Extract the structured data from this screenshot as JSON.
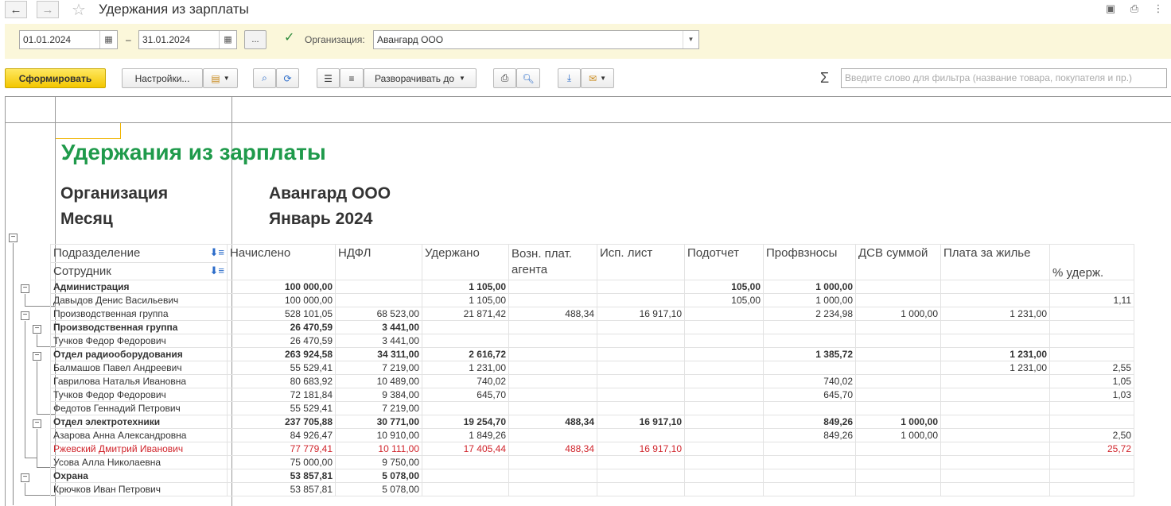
{
  "window": {
    "title": "Удержания из зарплаты"
  },
  "params": {
    "date_from": "01.01.2024",
    "date_to": "31.01.2024",
    "dash": "–",
    "more_button": "...",
    "org_label": "Организация:",
    "org_value": "Авангард ООО",
    "org_checked": true
  },
  "toolbar": {
    "generate": "Сформировать",
    "settings": "Настройки...",
    "expand_to": "Разворачивать до",
    "filter_placeholder": "Введите слово для фильтра (название товара, покупателя и пр.)",
    "sigma": "Σ"
  },
  "report": {
    "title": "Удержания из зарплаты",
    "org_label": "Организация",
    "org_value": "Авангард ООО",
    "month_label": "Месяц",
    "month_value": "Январь 2024",
    "colors": {
      "title": "#1f9a4b",
      "highlight_row": "#d0242b",
      "primary_button": "#f3c600"
    },
    "row_headers": [
      "Подразделение",
      "Сотрудник"
    ],
    "columns": [
      "Начислено",
      "НДФЛ",
      "Удержано",
      "Возн. плат. агента",
      "Исп. лист",
      "Подотчет",
      "Профвзносы",
      "ДСВ суммой",
      "Плата за жилье",
      "% удерж."
    ],
    "rows": [
      {
        "name": "Администрация",
        "bold": true,
        "values": [
          "100 000,00",
          "",
          "1 105,00",
          "",
          "",
          "105,00",
          "1 000,00",
          "",
          "",
          ""
        ]
      },
      {
        "name": "Давыдов Денис Васильевич",
        "values": [
          "100 000,00",
          "",
          "1 105,00",
          "",
          "",
          "105,00",
          "1 000,00",
          "",
          "",
          "1,11"
        ]
      },
      {
        "name": "Производственная группа",
        "values": [
          "528 101,05",
          "68 523,00",
          "21 871,42",
          "488,34",
          "16 917,10",
          "",
          "2 234,98",
          "1 000,00",
          "1 231,00",
          ""
        ]
      },
      {
        "name": "Производственная группа",
        "bold": true,
        "values": [
          "26 470,59",
          "3 441,00",
          "",
          "",
          "",
          "",
          "",
          "",
          "",
          ""
        ]
      },
      {
        "name": "Тучков Федор Федорович",
        "values": [
          "26 470,59",
          "3 441,00",
          "",
          "",
          "",
          "",
          "",
          "",
          "",
          ""
        ]
      },
      {
        "name": "Отдел радиооборудования",
        "bold": true,
        "values": [
          "263 924,58",
          "34 311,00",
          "2 616,72",
          "",
          "",
          "",
          "1 385,72",
          "",
          "1 231,00",
          ""
        ]
      },
      {
        "name": "Балмашов Павел Андреевич",
        "values": [
          "55 529,41",
          "7 219,00",
          "1 231,00",
          "",
          "",
          "",
          "",
          "",
          "1 231,00",
          "2,55"
        ]
      },
      {
        "name": "Гаврилова Наталья Ивановна",
        "values": [
          "80 683,92",
          "10 489,00",
          "740,02",
          "",
          "",
          "",
          "740,02",
          "",
          "",
          "1,05"
        ]
      },
      {
        "name": "Тучков Федор Федорович",
        "values": [
          "72 181,84",
          "9 384,00",
          "645,70",
          "",
          "",
          "",
          "645,70",
          "",
          "",
          "1,03"
        ]
      },
      {
        "name": "Федотов Геннадий Петрович",
        "values": [
          "55 529,41",
          "7 219,00",
          "",
          "",
          "",
          "",
          "",
          "",
          "",
          ""
        ]
      },
      {
        "name": "Отдел электротехники",
        "bold": true,
        "values": [
          "237 705,88",
          "30 771,00",
          "19 254,70",
          "488,34",
          "16 917,10",
          "",
          "849,26",
          "1 000,00",
          "",
          ""
        ]
      },
      {
        "name": "Азарова Анна Александровна",
        "values": [
          "84 926,47",
          "10 910,00",
          "1 849,26",
          "",
          "",
          "",
          "849,26",
          "1 000,00",
          "",
          "2,50"
        ]
      },
      {
        "name": "Ржевский Дмитрий Иванович",
        "red": true,
        "values": [
          "77 779,41",
          "10 111,00",
          "17 405,44",
          "488,34",
          "16 917,10",
          "",
          "",
          "",
          "",
          "25,72"
        ]
      },
      {
        "name": "Усова Алла Николаевна",
        "values": [
          "75 000,00",
          "9 750,00",
          "",
          "",
          "",
          "",
          "",
          "",
          "",
          ""
        ]
      },
      {
        "name": "Охрана",
        "bold": true,
        "values": [
          "53 857,81",
          "5 078,00",
          "",
          "",
          "",
          "",
          "",
          "",
          "",
          ""
        ]
      },
      {
        "name": "Крючков Иван Петрович",
        "values": [
          "53 857,81",
          "5 078,00",
          "",
          "",
          "",
          "",
          "",
          "",
          "",
          ""
        ]
      }
    ]
  }
}
